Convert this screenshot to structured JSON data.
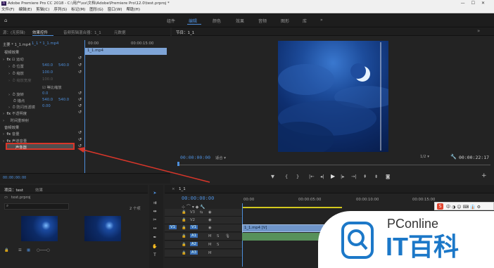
{
  "app": {
    "title": "Adobe Premiere Pro CC 2018 - C:\\用户\\xx\\文档\\Adobe\\Premiere Pro\\12.0\\test.prproj *",
    "icon_label": "Pr"
  },
  "menu": [
    "文件(F)",
    "编辑(E)",
    "剪辑(C)",
    "序列(S)",
    "标记(M)",
    "图形(G)",
    "窗口(W)",
    "帮助(H)"
  ],
  "workspaces": [
    {
      "label": "组件",
      "active": false
    },
    {
      "label": "编辑",
      "active": true
    },
    {
      "label": "颜色",
      "active": false
    },
    {
      "label": "效果",
      "active": false
    },
    {
      "label": "音频",
      "active": false
    },
    {
      "label": "图形",
      "active": false
    },
    {
      "label": "库",
      "active": false
    }
  ],
  "effects_panel": {
    "tabs": [
      "源：(无剪辑)",
      "效果控件",
      "音频剪辑混合器：1_1",
      "元数据"
    ],
    "clip_header": "主要 * 1_1.mp4",
    "seq_header": "1_1 * 1_1.mp4",
    "time_start": "00:00",
    "time_end": "00:00:15:00",
    "clip_bar": "1_1.mp4",
    "video_effects_label": "视频效果",
    "motion": "运动",
    "position": "位置",
    "position_x": "540.0",
    "position_y": "540.0",
    "scale": "缩放",
    "scale_val": "100.0",
    "scale_width": "缩放宽度",
    "scale_width_val": "100.0",
    "uniform_scale": "等比缩放",
    "rotation": "旋转",
    "rotation_val": "0.0",
    "anchor": "锚点",
    "anchor_x": "540.0",
    "anchor_y": "540.0",
    "antiflicker": "防闪烁滤镜",
    "antiflicker_val": "0.00",
    "opacity": "不透明度",
    "time_remap": "时间重映射",
    "audio_effects_label": "音频效果",
    "volume": "音量",
    "channel_volume": "声道音量",
    "panner": "声像器",
    "timecode": "00:00:00:00"
  },
  "program": {
    "tab": "节目：1_1",
    "timecode": "00:00:00:00",
    "fit": "适合",
    "fraction": "1/2",
    "duration": "00:00:22:17"
  },
  "project": {
    "tabs": [
      "项目：test",
      "效果"
    ],
    "file": "test.prproj",
    "count": "2 个项"
  },
  "timeline": {
    "tab": "1_1",
    "timecode": "00:00:00:00",
    "ruler": [
      "00:00",
      "00:00:05:00",
      "00:00:10:00",
      "00:00:15:00"
    ],
    "tracks": [
      "V3",
      "V2",
      "V1",
      "A1",
      "A2",
      "A3"
    ],
    "clip_label": "1_1.mp4 [V]"
  },
  "watermark": {
    "brand": "PConline",
    "logo_text": "IT百科"
  },
  "colors": {
    "accent": "#4d8edb",
    "highlight": "#d8362a"
  }
}
